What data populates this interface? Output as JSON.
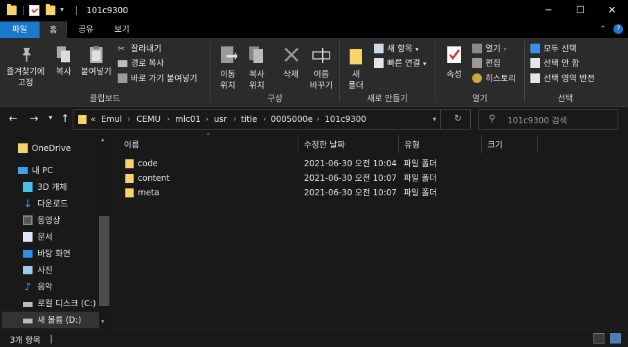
{
  "window": {
    "title": "101c9300",
    "minimize": "─",
    "maximize": "☐",
    "close": "✕"
  },
  "ribbon_tabs": [
    "파일",
    "홈",
    "공유",
    "보기"
  ],
  "ribbon": {
    "clipboard": {
      "pin_quick_access": "즐겨찾기에\n고정",
      "copy": "복사",
      "paste": "붙여넣기",
      "cut": "잘라내기",
      "copy_path": "경로 복사",
      "paste_shortcut": "바로 가기 붙여넣기",
      "group_label": "클립보드"
    },
    "organize": {
      "move_to": "이동\n위치",
      "copy_to": "복사\n위치",
      "delete": "삭제",
      "rename": "이름\n바꾸기",
      "group_label": "구성"
    },
    "new": {
      "new_folder": "새\n폴더",
      "new_item": "새 항목",
      "easy_access": "빠른 연결",
      "group_label": "새로 만들기"
    },
    "open": {
      "properties": "속성",
      "open": "열기",
      "edit": "편집",
      "history": "히스토리",
      "group_label": "열기"
    },
    "select": {
      "select_all": "모두 선택",
      "select_none": "선택 안 함",
      "invert_selection": "선택 영역 반전",
      "group_label": "선택"
    }
  },
  "address": {
    "overflow": "«",
    "crumbs": [
      "Emul",
      "CEMU",
      "mlc01",
      "usr",
      "title",
      "0005000e",
      "101c9300"
    ],
    "search_placeholder": "101c9300 검색"
  },
  "nav_pane": {
    "items": [
      {
        "label": "OneDrive",
        "icon": "onedrive-folder-icon"
      },
      {
        "label": "내 PC",
        "icon": "pc-icon"
      },
      {
        "label": "3D 개체",
        "icon": "3d-objects-icon"
      },
      {
        "label": "다운로드",
        "icon": "download-icon"
      },
      {
        "label": "동영상",
        "icon": "video-icon"
      },
      {
        "label": "문서",
        "icon": "document-icon"
      },
      {
        "label": "바탕 화면",
        "icon": "desktop-icon"
      },
      {
        "label": "사진",
        "icon": "pictures-icon"
      },
      {
        "label": "음악",
        "icon": "music-icon"
      },
      {
        "label": "로컬 디스크 (C:)",
        "icon": "drive-c-icon"
      },
      {
        "label": "새 볼륨 (D:)",
        "icon": "drive-d-icon"
      }
    ]
  },
  "file_list": {
    "columns": [
      "이름",
      "수정한 날짜",
      "유형",
      "크기"
    ],
    "rows": [
      {
        "name": "code",
        "modified": "2021-06-30 오전 10:04",
        "type": "파일 폴더"
      },
      {
        "name": "content",
        "modified": "2021-06-30 오전 10:07",
        "type": "파일 폴더"
      },
      {
        "name": "meta",
        "modified": "2021-06-30 오전 10:07",
        "type": "파일 폴더"
      }
    ]
  },
  "status": {
    "item_count": "3개 항목",
    "cursor": "|"
  },
  "colors": {
    "accent": "#1979ca",
    "folder": "#f8d26a",
    "background": "#191919",
    "ribbon": "#2b2b2b"
  }
}
